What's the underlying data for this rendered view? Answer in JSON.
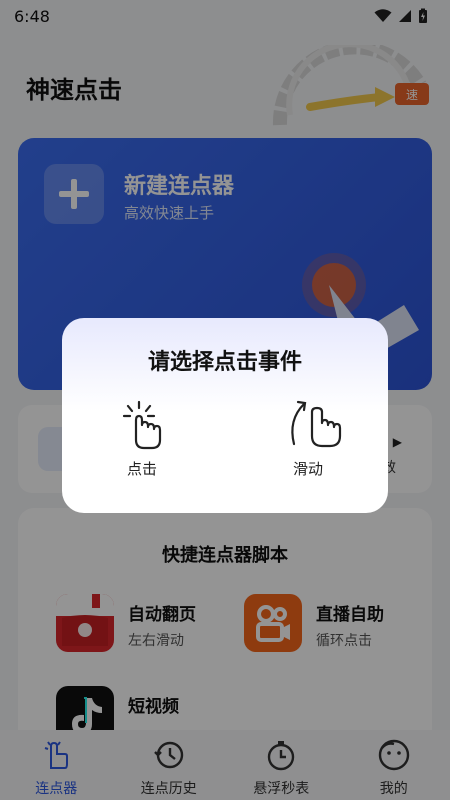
{
  "status_bar": {
    "time": "6:48"
  },
  "header": {
    "title": "神速点击",
    "speed_badge": "速"
  },
  "hero": {
    "title": "新建连点器",
    "subtitle": "高效快速上手"
  },
  "mid_card": {
    "right_text": "效"
  },
  "scripts": {
    "title": "快捷连点器脚本",
    "items": [
      {
        "name": "自动翻页",
        "desc": "左右滑动",
        "icon": "red-book-icon"
      },
      {
        "name": "直播自助",
        "desc": "循环点击",
        "icon": "kuaishou-icon"
      },
      {
        "name": "短视频",
        "desc": "",
        "icon": "tiktok-icon"
      }
    ]
  },
  "bottom_nav": [
    {
      "label": "连点器",
      "icon": "tap-hand-icon",
      "active": true
    },
    {
      "label": "连点历史",
      "icon": "history-clock-icon",
      "active": false
    },
    {
      "label": "悬浮秒表",
      "icon": "stopwatch-icon",
      "active": false
    },
    {
      "label": "我的",
      "icon": "profile-face-icon",
      "active": false
    }
  ],
  "dialog": {
    "title": "请选择点击事件",
    "options": [
      {
        "label": "点击",
        "icon": "tap-icon"
      },
      {
        "label": "滑动",
        "icon": "swipe-icon"
      }
    ]
  },
  "colors": {
    "accent": "#2d58e0",
    "hero_blue": "#3b6df0",
    "badge_orange": "#e8642c",
    "nav_active": "#2d58e0"
  }
}
